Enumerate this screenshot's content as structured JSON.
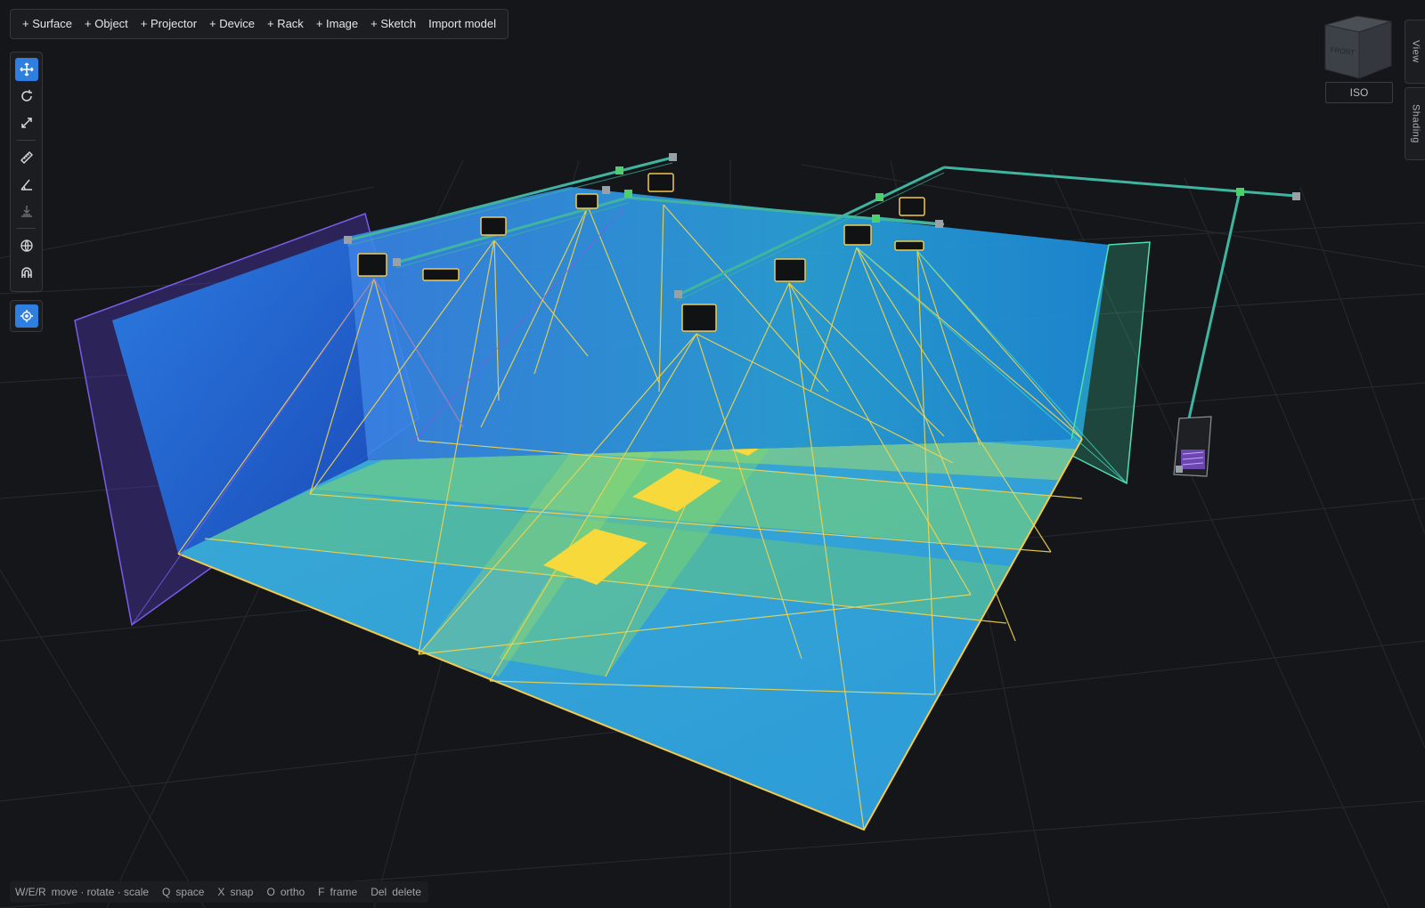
{
  "toolbar": {
    "items": [
      "+ Surface",
      "+ Object",
      "+ Projector",
      "+ Device",
      "+ Rack",
      "+ Image",
      "+ Sketch",
      "Import model"
    ]
  },
  "tools": {
    "move": "move-icon",
    "rotate": "rotate-icon",
    "scale": "scale-icon",
    "measure": "ruler-icon",
    "angle": "angle-icon",
    "drop": "drop-to-floor-icon",
    "globe": "globe-icon",
    "magnet": "magnet-icon",
    "focus": "crosshair-icon"
  },
  "view_cube": {
    "front_label": "FRONT",
    "iso_label": "ISO"
  },
  "side_tabs": {
    "view": "View",
    "shading": "Shading"
  },
  "status_bar": {
    "items": [
      {
        "key": "W/E/R",
        "desc": "move · rotate · scale"
      },
      {
        "key": "Q",
        "desc": "space"
      },
      {
        "key": "X",
        "desc": "snap"
      },
      {
        "key": "O",
        "desc": "ortho"
      },
      {
        "key": "F",
        "desc": "frame"
      },
      {
        "key": "Del",
        "desc": "delete"
      }
    ]
  },
  "colors": {
    "background": "#151619",
    "accent": "#2f7fe0",
    "projection_line": "#f2d44e",
    "floor_blue": "#2e9fd8",
    "floor_green": "#5fcf6a",
    "overlap_yellow": "#f7d93b",
    "truss": "#3fb5a0",
    "left_wall_edge": "#6b4fd8",
    "right_wall_edge": "#3fd8a8"
  }
}
